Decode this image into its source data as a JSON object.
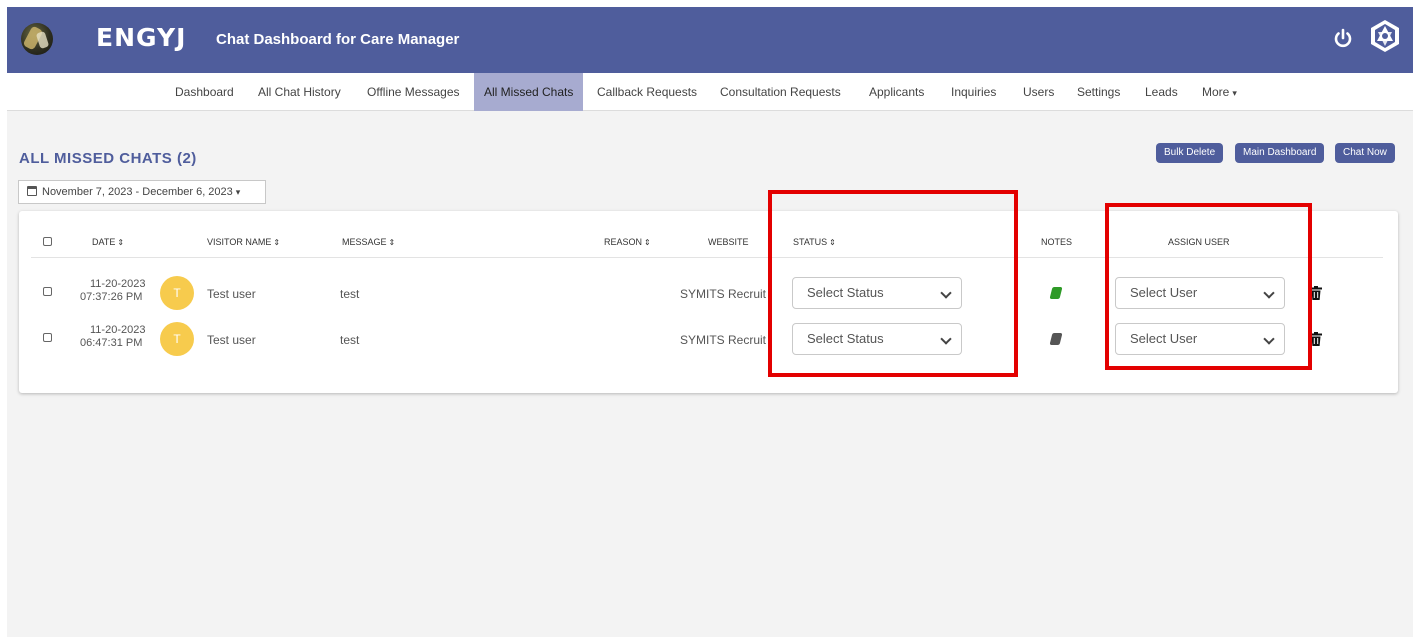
{
  "header": {
    "brand": "ENGYJ",
    "subtitle": "Chat Dashboard for Care Manager",
    "logo_icon": "logo-icon",
    "power_icon": "power-icon",
    "profile_icon": "gem-icon",
    "color": "#4f5d9c"
  },
  "nav": {
    "items": [
      {
        "label": "Dashboard"
      },
      {
        "label": "All Chat History"
      },
      {
        "label": "Offline Messages"
      },
      {
        "label": "All Missed Chats",
        "active": true
      },
      {
        "label": "Callback Requests"
      },
      {
        "label": "Consultation Requests"
      },
      {
        "label": "Applicants"
      },
      {
        "label": "Inquiries"
      },
      {
        "label": "Users"
      },
      {
        "label": "Settings"
      },
      {
        "label": "Leads"
      },
      {
        "label": "More"
      }
    ],
    "active_color": "#a7abd0"
  },
  "page": {
    "title": "ALL MISSED CHATS (2)",
    "date_range": "November 7, 2023 - December 6, 2023",
    "buttons": {
      "bulk_delete": "Bulk Delete",
      "main_dashboard": "Main Dashboard",
      "chat_now": "Chat Now"
    }
  },
  "table": {
    "columns": {
      "date": "DATE",
      "visitor_name": "VISITOR NAME",
      "message": "MESSAGE",
      "reason": "REASON",
      "website": "WEBSITE",
      "status": "STATUS",
      "notes": "NOTES",
      "assign_user": "ASSIGN USER"
    },
    "rows": [
      {
        "date": "11-20-2023",
        "time": "07:37:26 PM",
        "avatar_initial": "T",
        "visitor_name": "Test user",
        "message": "test",
        "reason": "",
        "website": "SYMITS Recruit",
        "status_select": "Select Status",
        "note_color": "#2e9a27",
        "assign_select": "Select User"
      },
      {
        "date": "11-20-2023",
        "time": "06:47:31 PM",
        "avatar_initial": "T",
        "visitor_name": "Test user",
        "message": "test",
        "reason": "",
        "website": "SYMITS Recruit",
        "status_select": "Select Status",
        "note_color": "#555555",
        "assign_select": "Select User"
      }
    ]
  },
  "highlight_color": "#e30000"
}
